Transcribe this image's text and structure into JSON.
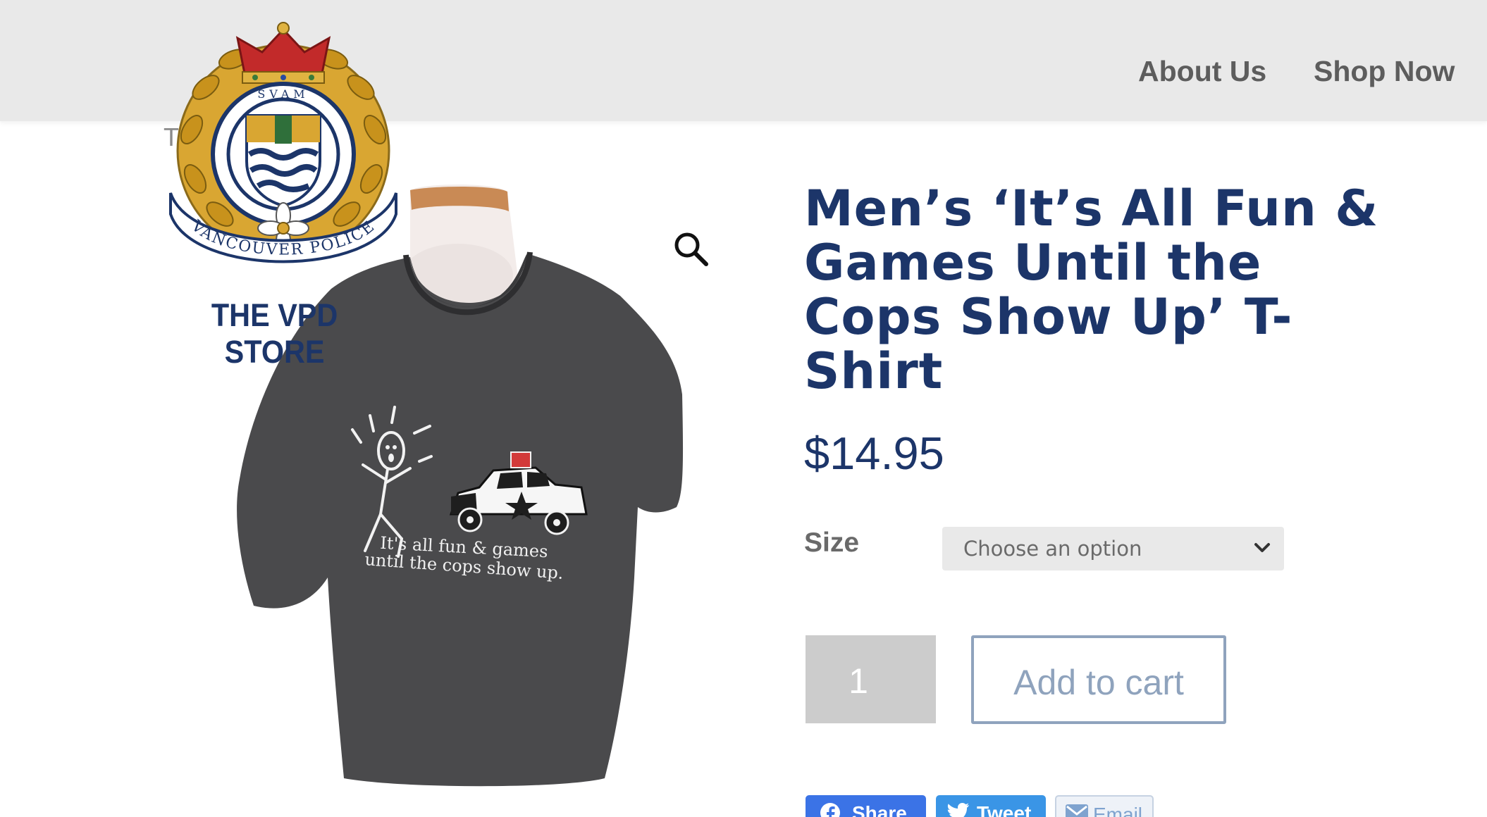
{
  "header": {
    "nav": [
      {
        "label": "About Us"
      },
      {
        "label": "Shop Now"
      }
    ]
  },
  "logo": {
    "text": "THE VPD STORE",
    "banner_text": "VANCOUVER POLICE",
    "crest_motto": "SVAM"
  },
  "breadcrumb": {
    "text": "T-"
  },
  "product": {
    "title": "Men’s ‘It’s All Fun & Games Until the Cops Show Up’ T-Shirt",
    "price": "$14.95",
    "shirt_print_line1": "It's all fun & games",
    "shirt_print_line2": "until the cops show up.",
    "image_icons": {
      "zoom": "magnifier-icon"
    }
  },
  "options": {
    "size_label": "Size",
    "size_select_value": "Choose an option"
  },
  "cart": {
    "quantity": "1",
    "add_to_cart_label": "Add to cart"
  },
  "share": {
    "facebook_label": "Share",
    "twitter_label": "Tweet",
    "email_label": "Email"
  },
  "colors": {
    "brand_navy": "#1c3569",
    "header_bg": "#e9e9e9",
    "button_outline": "#8fa3bd",
    "facebook": "#3b73e6",
    "twitter": "#3a95e6"
  }
}
